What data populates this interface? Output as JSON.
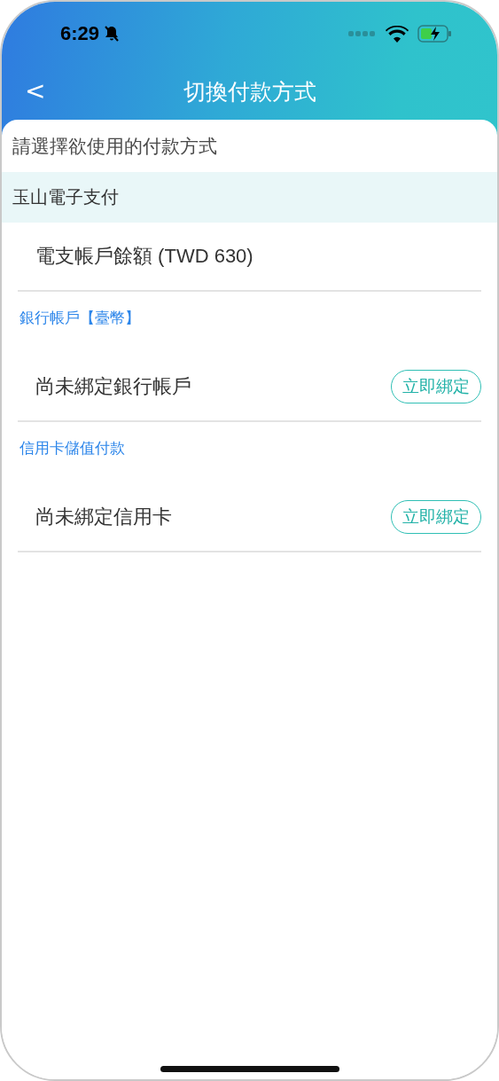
{
  "status_bar": {
    "time": "6:29"
  },
  "nav": {
    "back": "<",
    "title": "切換付款方式"
  },
  "prompt": "請選擇欲使用的付款方式",
  "group": {
    "title": "玉山電子支付"
  },
  "balance": {
    "label": "電支帳戶餘額 (TWD 630)"
  },
  "sections": [
    {
      "label": "銀行帳戶【臺幣】",
      "item": "尚未綁定銀行帳戶",
      "action": "立即綁定"
    },
    {
      "label": "信用卡儲值付款",
      "item": "尚未綁定信用卡",
      "action": "立即綁定"
    }
  ]
}
